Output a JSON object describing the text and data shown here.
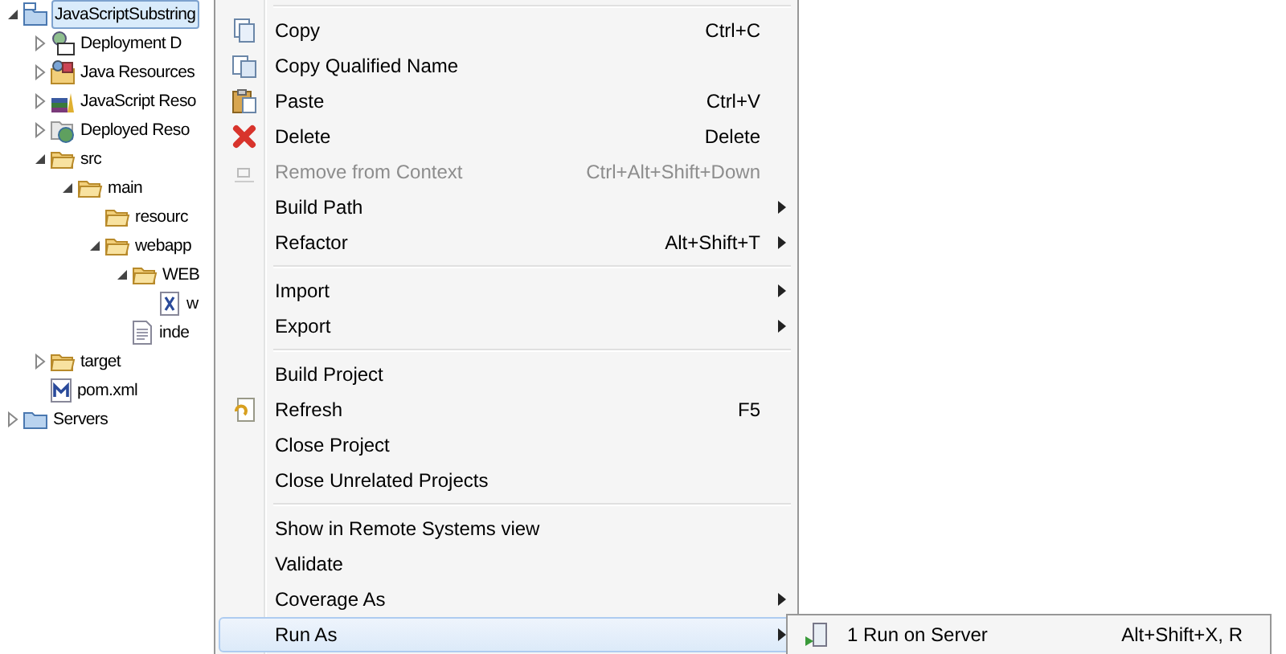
{
  "project_tree": [
    {
      "label": "JavaScriptSubstring",
      "expanded": true,
      "selected": true,
      "children": [
        {
          "label": "Deployment D",
          "expanded": false,
          "selected": false
        },
        {
          "label": "Java Resources",
          "expanded": false,
          "selected": false
        },
        {
          "label": "JavaScript Reso",
          "expanded": false,
          "selected": false
        },
        {
          "label": "Deployed Reso",
          "expanded": false,
          "selected": false
        },
        {
          "label": "src",
          "expanded": true,
          "selected": false,
          "children": [
            {
              "label": "main",
              "expanded": true,
              "selected": false,
              "children": [
                {
                  "label": "resourc",
                  "selected": false
                },
                {
                  "label": "webapp",
                  "expanded": true,
                  "selected": false,
                  "children": [
                    {
                      "label": "WEB",
                      "expanded": true,
                      "selected": false,
                      "children": [
                        {
                          "label": "w",
                          "selected": false
                        }
                      ]
                    },
                    {
                      "label": "inde",
                      "selected": false
                    }
                  ]
                }
              ]
            }
          ]
        },
        {
          "label": "target",
          "expanded": false,
          "selected": false
        },
        {
          "label": "pom.xml",
          "selected": false
        }
      ]
    },
    {
      "label": "Servers",
      "expanded": false,
      "selected": false
    }
  ],
  "context_menu": [
    {
      "kind": "separator"
    },
    {
      "kind": "item",
      "label": "Copy",
      "shortcut": "Ctrl+C",
      "submenu": false,
      "disabled": false,
      "selected": false
    },
    {
      "kind": "item",
      "label": "Copy Qualified Name",
      "submenu": false,
      "disabled": false,
      "selected": false
    },
    {
      "kind": "item",
      "label": "Paste",
      "shortcut": "Ctrl+V",
      "submenu": false,
      "disabled": false,
      "selected": false
    },
    {
      "kind": "item",
      "label": "Delete",
      "shortcut": "Delete",
      "submenu": false,
      "disabled": false,
      "selected": false
    },
    {
      "kind": "item",
      "label": "Remove from Context",
      "shortcut": "Ctrl+Alt+Shift+Down",
      "submenu": false,
      "disabled": true,
      "selected": false
    },
    {
      "kind": "item",
      "label": "Build Path",
      "submenu": true,
      "disabled": false,
      "selected": false
    },
    {
      "kind": "item",
      "label": "Refactor",
      "shortcut": "Alt+Shift+T",
      "submenu": true,
      "disabled": false,
      "selected": false
    },
    {
      "kind": "separator"
    },
    {
      "kind": "item",
      "label": "Import",
      "submenu": true,
      "disabled": false,
      "selected": false
    },
    {
      "kind": "item",
      "label": "Export",
      "submenu": true,
      "disabled": false,
      "selected": false
    },
    {
      "kind": "separator"
    },
    {
      "kind": "item",
      "label": "Build Project",
      "submenu": false,
      "disabled": false,
      "selected": false
    },
    {
      "kind": "item",
      "label": "Refresh",
      "shortcut": "F5",
      "submenu": false,
      "disabled": false,
      "selected": false
    },
    {
      "kind": "item",
      "label": "Close Project",
      "submenu": false,
      "disabled": false,
      "selected": false
    },
    {
      "kind": "item",
      "label": "Close Unrelated Projects",
      "submenu": false,
      "disabled": false,
      "selected": false
    },
    {
      "kind": "separator"
    },
    {
      "kind": "item",
      "label": "Show in Remote Systems view",
      "submenu": false,
      "disabled": false,
      "selected": false
    },
    {
      "kind": "item",
      "label": "Validate",
      "submenu": false,
      "disabled": false,
      "selected": false
    },
    {
      "kind": "item",
      "label": "Coverage As",
      "submenu": true,
      "disabled": false,
      "selected": false
    },
    {
      "kind": "item",
      "label": "Run As",
      "submenu": true,
      "disabled": false,
      "selected": true
    }
  ],
  "run_as_submenu": [
    {
      "label": "1 Run on Server",
      "shortcut": "Alt+Shift+X, R",
      "selected": false
    }
  ]
}
